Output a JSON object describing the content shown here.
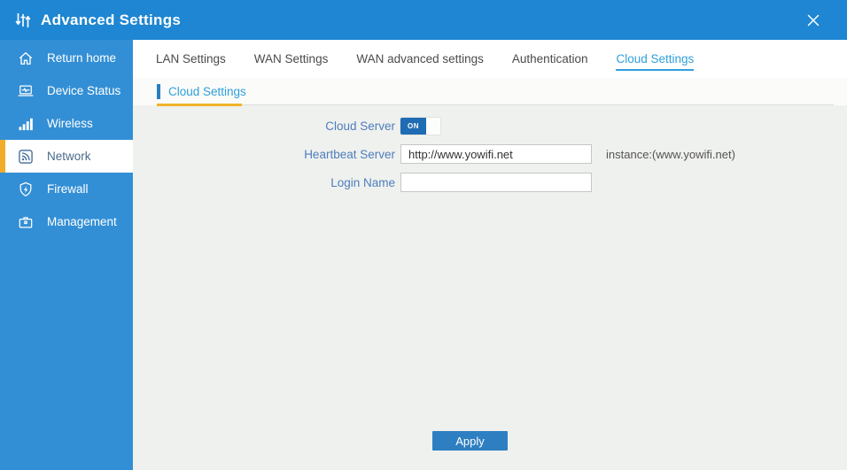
{
  "header": {
    "title": "Advanced Settings"
  },
  "sidebar": {
    "items": [
      {
        "label": "Return home",
        "icon": "home-icon",
        "active": false
      },
      {
        "label": "Device Status",
        "icon": "device-status-icon",
        "active": false
      },
      {
        "label": "Wireless",
        "icon": "wireless-signal-icon",
        "active": false
      },
      {
        "label": "Network",
        "icon": "network-icon",
        "active": true
      },
      {
        "label": "Firewall",
        "icon": "firewall-shield-icon",
        "active": false
      },
      {
        "label": "Management",
        "icon": "management-icon",
        "active": false
      }
    ]
  },
  "tabs": [
    {
      "label": "LAN Settings",
      "active": false
    },
    {
      "label": "WAN Settings",
      "active": false
    },
    {
      "label": "WAN advanced settings",
      "active": false
    },
    {
      "label": "Authentication",
      "active": false
    },
    {
      "label": "Cloud Settings",
      "active": true
    }
  ],
  "section": {
    "title": "Cloud Settings"
  },
  "form": {
    "cloud_server": {
      "label": "Cloud Server",
      "state": "ON"
    },
    "heartbeat_server": {
      "label": "Heartbeat Server",
      "value": "http://www.yowifi.net",
      "hint": "instance:(www.yowifi.net)"
    },
    "login_name": {
      "label": "Login Name",
      "value": ""
    }
  },
  "actions": {
    "apply_label": "Apply"
  },
  "colors": {
    "header_bg": "#1E86D2",
    "sidebar_bg": "#338FD5",
    "selected_item_accent": "#F2AC29",
    "section_underline": "#F2B32A",
    "active_tab_blue": "#2FA0DC",
    "form_label_blue": "#4E7DBD",
    "toggle_on_blue": "#1F6CB4",
    "apply_button_blue": "#2E7FC2",
    "content_bg": "#EFF1EE"
  }
}
